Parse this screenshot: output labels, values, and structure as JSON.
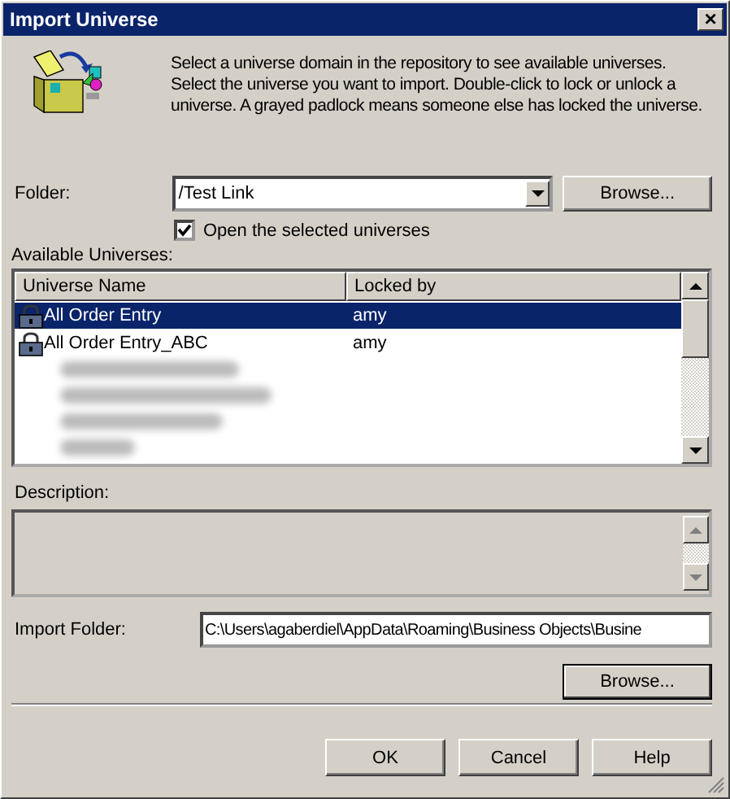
{
  "window": {
    "title": "Import Universe",
    "close": "×"
  },
  "intro": "Select a universe domain in the repository to see available universes. Select the universe you want to import. Double-click to lock or unlock a universe. A grayed padlock means someone else has locked the universe.",
  "folder": {
    "label": "Folder:",
    "value": "/Test Link",
    "browse": "Browse..."
  },
  "open_selected": {
    "label": "Open the selected universes",
    "checked": true
  },
  "universes": {
    "label": "Available Universes:",
    "columns": [
      "Universe Name",
      "Locked by"
    ],
    "rows": [
      {
        "name": "All Order Entry",
        "locked_by": "amy",
        "selected": true
      },
      {
        "name": "All Order Entry_ABC",
        "locked_by": "amy",
        "selected": false
      }
    ]
  },
  "description": {
    "label": "Description:"
  },
  "import_folder": {
    "label": "Import Folder:",
    "value": "C:\\Users\\agaberdiel\\AppData\\Roaming\\Business Objects\\Busine",
    "browse": "Browse..."
  },
  "buttons": [
    "OK",
    "Cancel",
    "Help"
  ]
}
